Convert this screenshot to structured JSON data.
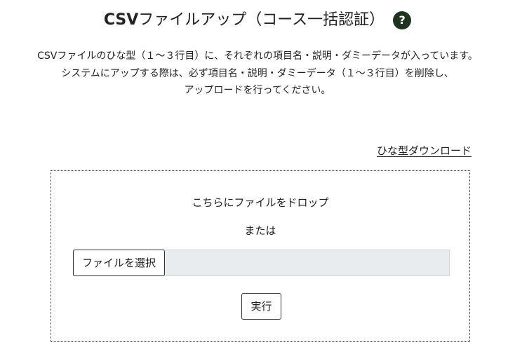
{
  "header": {
    "title_prefix": "CSV",
    "title_rest": "ファイルアップ（コース一括認証）",
    "help_icon_glyph": "?"
  },
  "description": {
    "lines": [
      "CSVファイルのひな型（１～３行目）に、それぞれの項目名・説明・ダミーデータが入っています。",
      "システムにアップする際は、必ず項目名・説明・ダミーデータ（１～３行目）を削除し、",
      "アップロードを行ってください。"
    ]
  },
  "template_download": {
    "label": "ひな型ダウンロード"
  },
  "upload": {
    "drop_text": "こちらにファイルをドロップ",
    "or_text": "または",
    "choose_button_label": "ファイルを選択",
    "selected_file": "",
    "run_button_label": "実行"
  },
  "colors": {
    "help_icon_bg": "#1f3321",
    "file_bar_bg": "#e9ecef",
    "text": "#222222"
  }
}
